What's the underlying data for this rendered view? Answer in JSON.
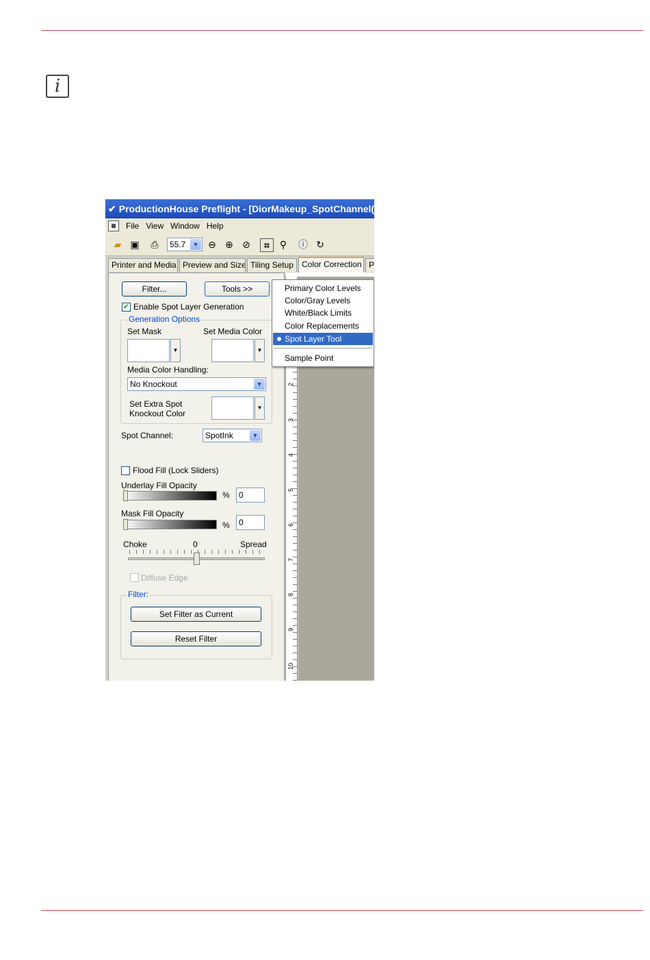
{
  "colors": {
    "rule": "#d9475b",
    "title_bar": "#2558c4",
    "selection": "#316ac5",
    "canvas": "#aba79a"
  },
  "app": {
    "title": "ProductionHouse Preflight - [DiorMakeup_SpotChannel(",
    "menus": [
      "File",
      "View",
      "Window",
      "Help"
    ],
    "zoom": "55.7"
  },
  "tabs": [
    "Printer and Media",
    "Preview and Size",
    "Tiling Setup",
    "Color Correction",
    "Pr"
  ],
  "panel": {
    "filter_button": "Filter...",
    "tools_button": "Tools >>",
    "enable_spot": "Enable Spot Layer Generation",
    "generation_options": "Generation Options",
    "set_mask": "Set Mask",
    "set_media_color": "Set Media Color",
    "media_color_handling": "Media Color Handling:",
    "knockout_value": "No Knockout",
    "set_extra_spot_1": "Set Extra Spot",
    "set_extra_spot_2": "Knockout Color",
    "spot_channel_label": "Spot Channel:",
    "spot_channel_value": "SpotInk",
    "flood_fill": "Flood Fill (Lock Sliders)",
    "underlay_label": "Underlay Fill Opacity",
    "underlay_value": "0",
    "mask_label": "Mask Fill Opacity",
    "mask_value": "0",
    "percent": "%",
    "choke": "Choke",
    "choke_value": "0",
    "spread": "Spread",
    "diffuse_edge": "Diffuse Edge",
    "filter_group": "Filter:",
    "set_filter_current": "Set Filter as Current",
    "reset_filter": "Reset Filter"
  },
  "ruler_numbers": [
    "2",
    "3",
    "4",
    "5",
    "6",
    "7",
    "8",
    "9",
    "10"
  ],
  "dropdown": {
    "items": [
      "Primary Color Levels",
      "Color/Gray Levels",
      "White/Black Limits",
      "Color Replacements",
      "Spot Layer Tool",
      "Sample Point"
    ],
    "selected": "Spot Layer Tool"
  },
  "icons": [
    "info-icon",
    "app-logo-icon",
    "open-folder-icon",
    "save-icon",
    "print-icon",
    "zoom-out-icon",
    "zoom-in-icon",
    "zoom-fit-icon",
    "crop-icon",
    "magnifier-icon",
    "info-circle-icon",
    "rotate-icon"
  ]
}
